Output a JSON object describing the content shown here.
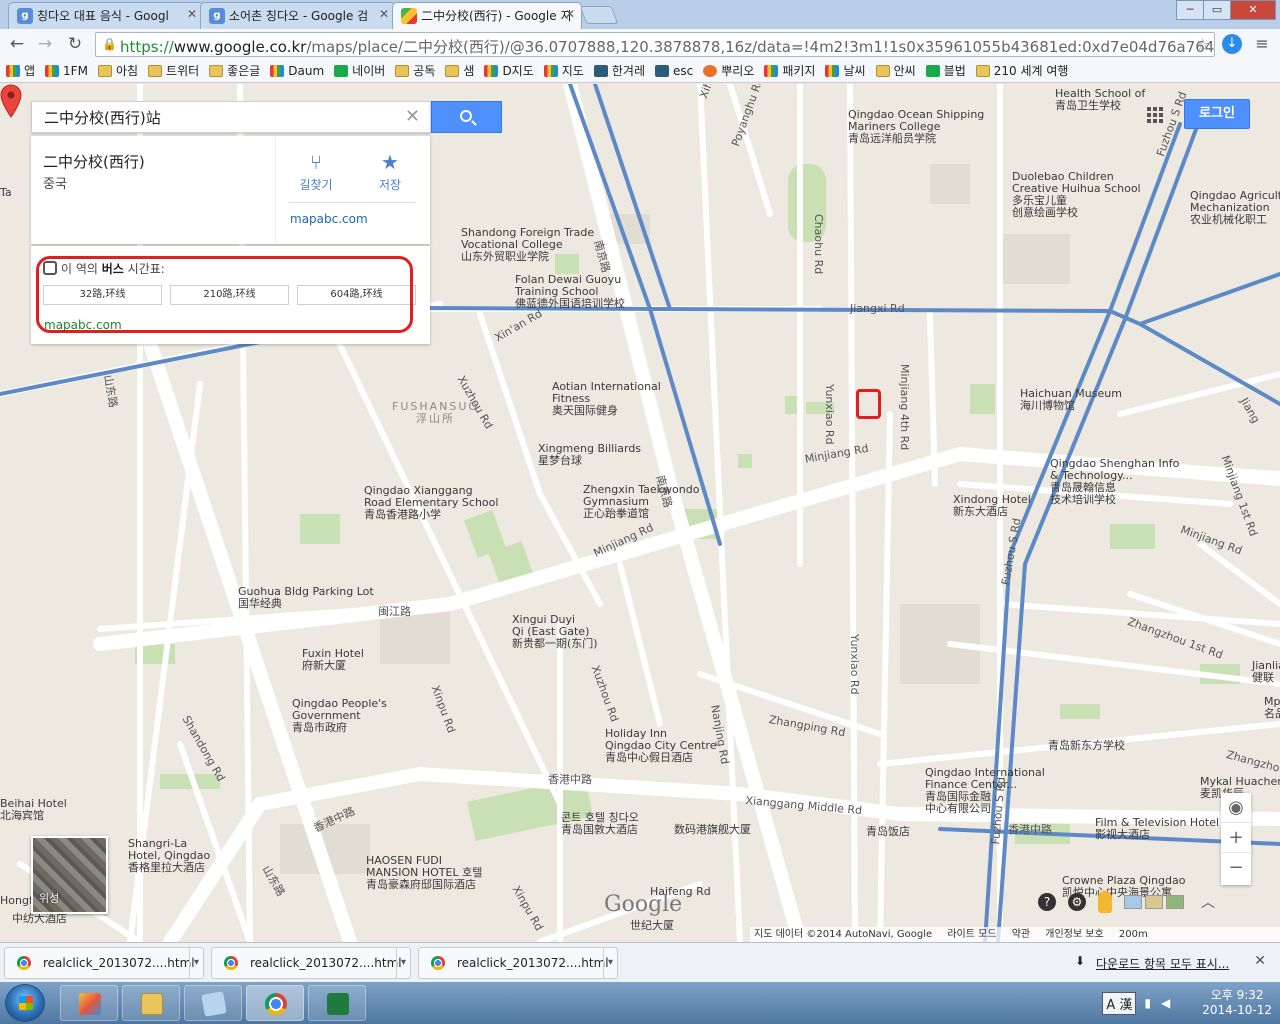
{
  "browser": {
    "tabs": [
      {
        "title": "칭다오 대표 음식 - Googl",
        "icon": "google-g-icon",
        "active": false
      },
      {
        "title": "소어촌 칭다오 - Google 검",
        "icon": "google-g-icon",
        "active": false
      },
      {
        "title": "二中分校(西行) - Google 지",
        "icon": "google-maps-icon",
        "active": true
      }
    ],
    "window_controls": [
      "─",
      "▭",
      "✕"
    ],
    "url": {
      "scheme": "https://",
      "host": "www.google.co.kr",
      "path": "/maps/place/二中分校(西行)/@36.0707888,120.3878878,16z/data=!4m2!3m1!1s0x35961055b43681ed:0xd7e04d76a7644"
    },
    "bookmarks": [
      {
        "label": "앱",
        "icon": "multi"
      },
      {
        "label": "1FM",
        "icon": "multi"
      },
      {
        "label": "아침",
        "icon": "folder"
      },
      {
        "label": "트위터",
        "icon": "folder"
      },
      {
        "label": "좋은글",
        "icon": "folder"
      },
      {
        "label": "Daum",
        "icon": "multi"
      },
      {
        "label": "네이버",
        "icon": "green"
      },
      {
        "label": "공독",
        "icon": "folder"
      },
      {
        "label": "샘",
        "icon": "folder"
      },
      {
        "label": "D지도",
        "icon": "multi"
      },
      {
        "label": "지도",
        "icon": "multi"
      },
      {
        "label": "한겨레",
        "icon": "dark"
      },
      {
        "label": "esc",
        "icon": "dark"
      },
      {
        "label": "뿌리오",
        "icon": "fox"
      },
      {
        "label": "패키지",
        "icon": "multi"
      },
      {
        "label": "날씨",
        "icon": "multi"
      },
      {
        "label": "안씨",
        "icon": "folder"
      },
      {
        "label": "블법",
        "icon": "green"
      },
      {
        "label": "210 세계 여행",
        "icon": "folder"
      }
    ]
  },
  "search": {
    "query": "二中分校(西行)站"
  },
  "place": {
    "name": "二中分校(西行)",
    "country": "중국",
    "directions_label": "길찾기",
    "save_label": "저장",
    "source_link": "mapabc.com"
  },
  "bus": {
    "title_prefix": "이 역의 ",
    "title_bold": "버스",
    "title_suffix": " 시간표:",
    "routes": [
      "32路,环线",
      "210路,环线",
      "604路,环线"
    ],
    "source_link": "mapabc.com"
  },
  "top_controls": {
    "login_label": "로그인"
  },
  "map": {
    "district": {
      "en": "FUSHANSUO",
      "zh": "浮山所"
    },
    "labels": [
      {
        "text": "Health School of\n青岛卫生学校"
      },
      {
        "text": "Qingdao Ocean Shipping\nMariners College\n青岛远洋船员学院"
      },
      {
        "text": "Duolebao Children\nCreative Huihua School\n多乐宝儿童\n创意绘画学校"
      },
      {
        "text": "Qingdao Agricultu\nMechanization\n农业机械化职工"
      },
      {
        "text": "Shandong Foreign Trade\nVocational College\n山东外贸职业学院"
      },
      {
        "text": "Folan Dewai Guoyu\nTraining School\n佛蓝德外国语培训学校"
      },
      {
        "text": "Aotian International\nFitness\n奥天国际健身"
      },
      {
        "text": "Haichuan Museum\n海川博物馆"
      },
      {
        "text": "Xingmeng Billiards\n星梦台球"
      },
      {
        "text": "Qingdao Shenghan Info\n& Technology...\n青岛晟翰信息\n技术培训学校"
      },
      {
        "text": "Qingdao Xianggang\nRoad Elementary School\n青岛香港路小学"
      },
      {
        "text": "Zhengxin Taekwondo\nGymnasium\n正心跆拳道馆"
      },
      {
        "text": "Xindong Hotel\n新东大酒店"
      },
      {
        "text": "Guohua Bldg Parking Lot\n国华经典"
      },
      {
        "text": "Xingui Duyi\nQi (East Gate)\n新贵都一期(东门)"
      },
      {
        "text": "Fuxin Hotel\n府新大厦"
      },
      {
        "text": "Qingdao People's\nGovernment\n青岛市政府"
      },
      {
        "text": "Holiday Inn\nQingdao City Centre\n青岛中心假日酒店"
      },
      {
        "text": "Qingdao International\nFinance Center...\n青岛国际金融\n中心有限公司"
      },
      {
        "text": "青岛新东方学校"
      },
      {
        "text": "Jianlian Ho\n健联"
      },
      {
        "text": "Mpin Pla\n名品广"
      },
      {
        "text": "Mykal Huachen\n麦凯华辰"
      },
      {
        "text": "Film & Television Hotel\n影视大酒店"
      },
      {
        "text": "Beihai Hotel\n北海宾馆"
      },
      {
        "text": "Shangri-La\nHotel, Qingdao\n香格里拉大酒店"
      },
      {
        "text": "콘트 호텔 칭다오\n青岛国敦大酒店"
      },
      {
        "text": "数码港旗舰大厦"
      },
      {
        "text": "青岛饭店"
      },
      {
        "text": "HAOSEN FUDI\nMANSION HOTEL 호텔\n青岛豪森府邸国际酒店"
      },
      {
        "text": "Haifeng Rd"
      },
      {
        "text": "世纪大厦"
      },
      {
        "text": "Crowne Plaza Qingdao\n凯悦中心中央海景公寓"
      },
      {
        "text": "中纺大酒店"
      },
      {
        "text": "Hongfa"
      },
      {
        "text": "Ta"
      }
    ],
    "roads": [
      "Jiangxi Rd",
      "Minjiang Rd",
      "Minjiang Rd",
      "Minjiang 1st Rd",
      "Minjiang 4th Rd",
      "Xuzhou Rd",
      "Xin'an Rd",
      "Poyanghu Rd",
      "Chaohu Rd",
      "Yunxiao Rd",
      "Yunxiao Rd",
      "南京路",
      "南京路",
      "Nanjing Rd",
      "Xuzhou Rd",
      "Xinpu Rd",
      "Xinpu Rd",
      "Shandong Rd",
      "山东路",
      "山东路",
      "闽江路",
      "香港中路",
      "香港中路",
      "Xianggang Middle Rd",
      "Zhangping Rd",
      "Zhangzhou 1st Rd",
      "Zhangzhou 2r",
      "Fuzhou S Rd",
      "Fuzhou S Rd",
      "Fuzhou S Rd",
      "Minjiang Rd",
      "Jiang",
      "Xia",
      "Xihu Rd",
      "香港中路",
      "Xi",
      "Huaih"
    ],
    "google_logo": "Google",
    "satellite_label": "위성",
    "footer": [
      "지도 데이터 ©2014 AutoNavi, Google",
      "라이트 모드",
      "약관",
      "개인정보 보호",
      "200m"
    ]
  },
  "downloads": {
    "items": [
      "realclick_2013072....html",
      "realclick_2013072....html",
      "realclick_2013072....html"
    ],
    "show_all": "다운로드 항목 모두 표시..."
  },
  "taskbar": {
    "ime_label": "A 漢",
    "time": "오후 9:32",
    "date": "2014-10-12"
  }
}
